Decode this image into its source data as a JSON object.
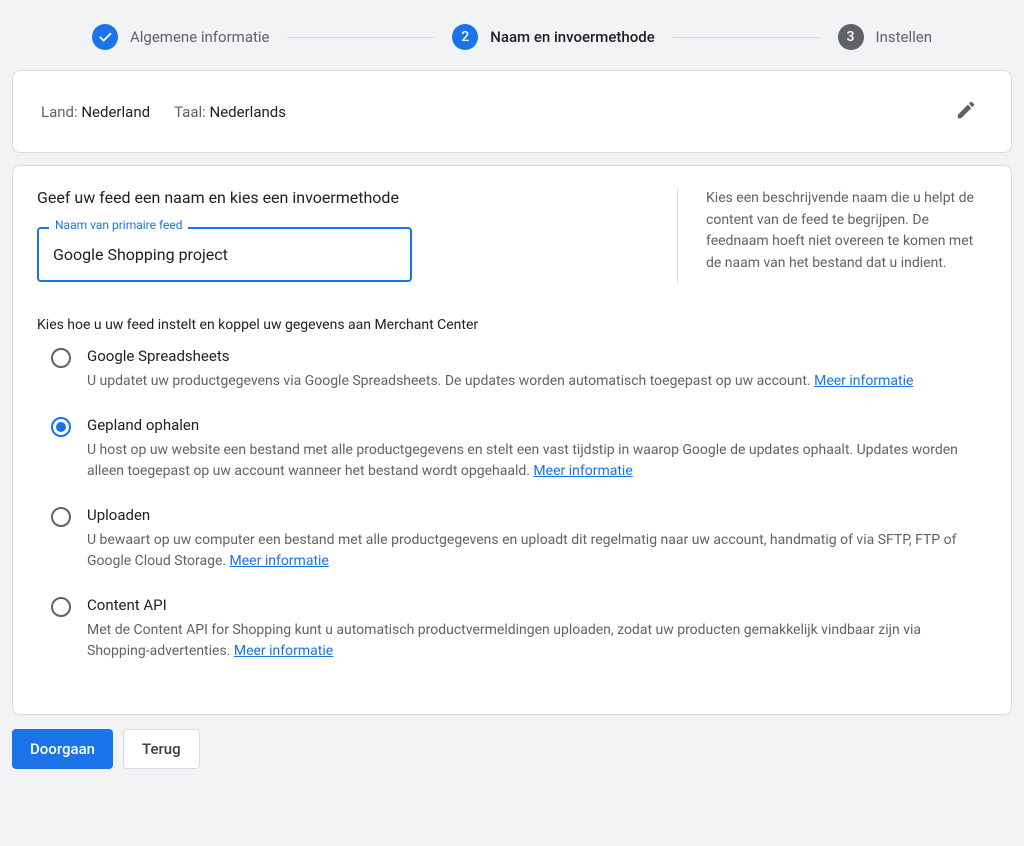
{
  "stepper": {
    "steps": [
      {
        "label": "Algemene informatie",
        "state": "done"
      },
      {
        "num": "2",
        "label": "Naam en invoermethode",
        "state": "active"
      },
      {
        "num": "3",
        "label": "Instellen",
        "state": "pending"
      }
    ]
  },
  "summary": {
    "country_label": "Land:",
    "country_value": "Nederland",
    "lang_label": "Taal:",
    "lang_value": "Nederlands"
  },
  "main": {
    "heading": "Geef uw feed een naam en kies een invoermethode",
    "field_legend": "Naam van primaire feed",
    "field_value": "Google Shopping project",
    "help_text": "Kies een beschrijvende naam die u helpt de content van de feed te begrijpen. De feednaam hoeft niet overeen te komen met de naam van het bestand dat u indient.",
    "subheading": "Kies hoe u uw feed instelt en koppel uw gegevens aan Merchant Center",
    "more_info": "Meer informatie",
    "options": [
      {
        "title": "Google Spreadsheets",
        "desc": "U updatet uw productgegevens via Google Spreadsheets. De updates worden automatisch toegepast op uw account.",
        "selected": false
      },
      {
        "title": "Gepland ophalen",
        "desc": "U host op uw website een bestand met alle productgegevens en stelt een vast tijdstip in waarop Google de updates ophaalt. Updates worden alleen toegepast op uw account wanneer het bestand wordt opgehaald.",
        "selected": true
      },
      {
        "title": "Uploaden",
        "desc": "U bewaart op uw computer een bestand met alle productgegevens en uploadt dit regelmatig naar uw account, handmatig of via SFTP, FTP of Google Cloud Storage.",
        "selected": false
      },
      {
        "title": "Content API",
        "desc": "Met de Content API for Shopping kunt u automatisch productvermeldingen uploaden, zodat uw producten gemakkelijk vindbaar zijn via Shopping-advertenties.",
        "selected": false
      }
    ]
  },
  "buttons": {
    "continue": "Doorgaan",
    "back": "Terug"
  }
}
